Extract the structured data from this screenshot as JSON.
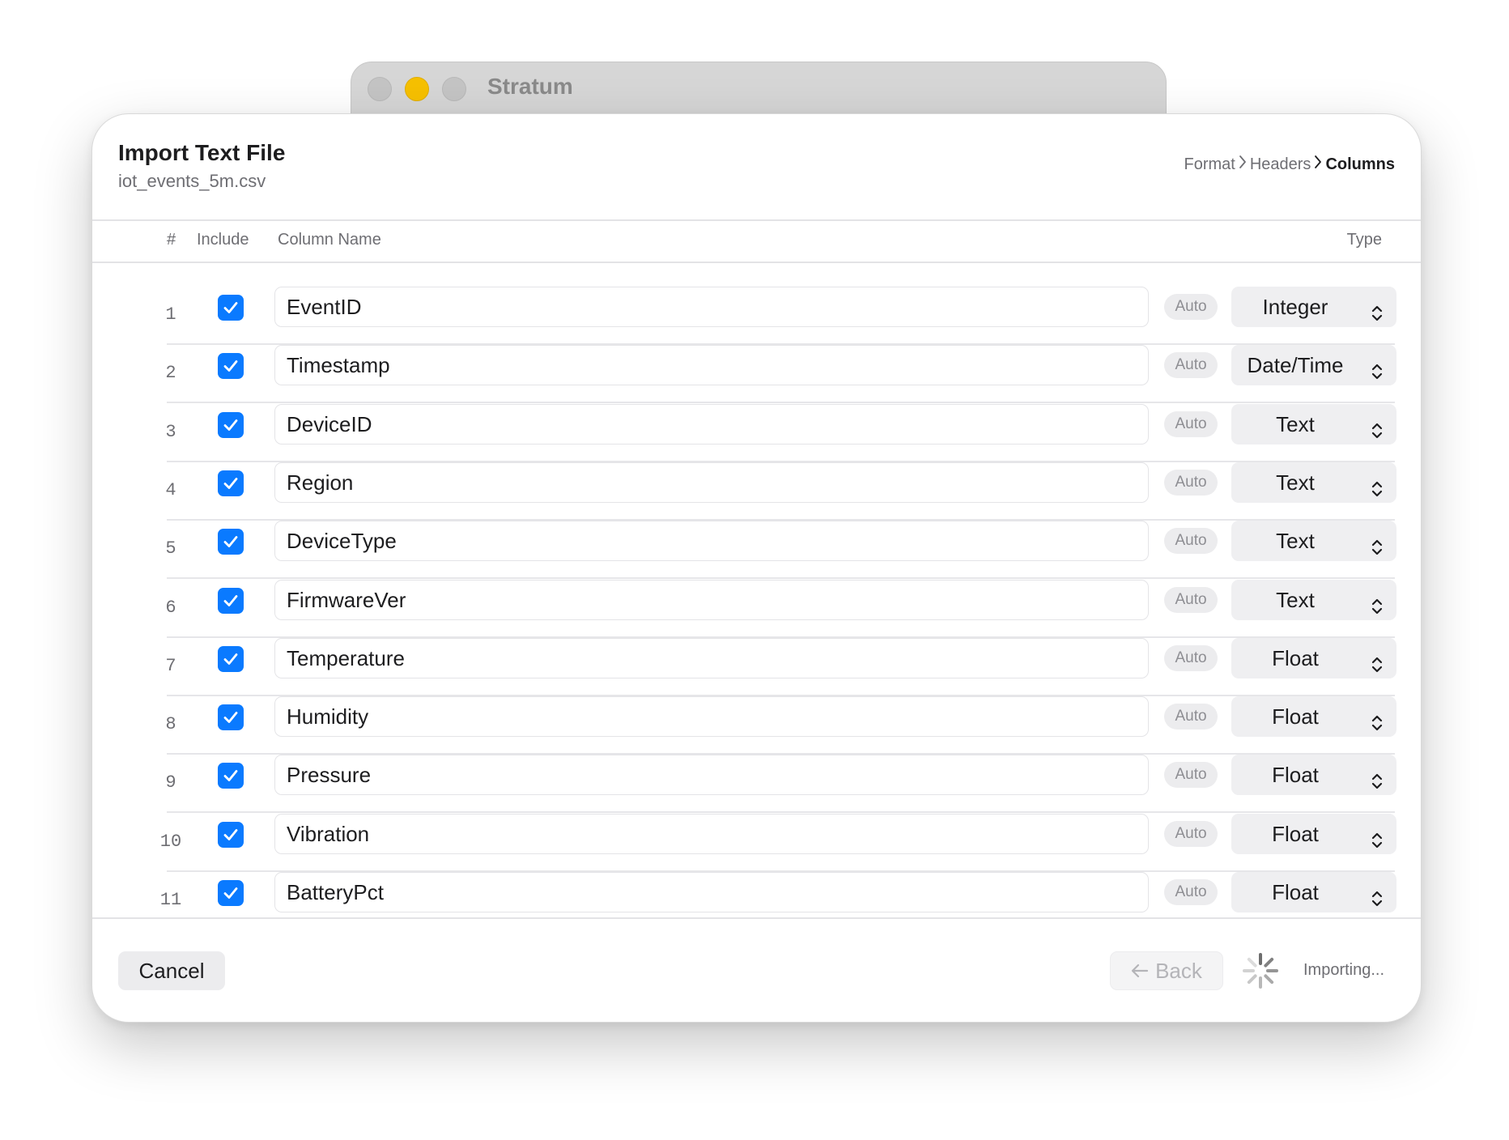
{
  "app": {
    "window_title": "Stratum"
  },
  "dialog": {
    "title": "Import Text File",
    "filename": "iot_events_5m.csv",
    "breadcrumb": [
      {
        "label": "Format",
        "current": false
      },
      {
        "label": "Headers",
        "current": false
      },
      {
        "label": "Columns",
        "current": true
      }
    ]
  },
  "table": {
    "headers": {
      "num": "#",
      "include": "Include",
      "name": "Column Name",
      "type": "Type"
    },
    "rows": [
      {
        "num": "1",
        "included": true,
        "name": "EventID",
        "badge": "Auto",
        "type": "Integer"
      },
      {
        "num": "2",
        "included": true,
        "name": "Timestamp",
        "badge": "Auto",
        "type": "Date/Time"
      },
      {
        "num": "3",
        "included": true,
        "name": "DeviceID",
        "badge": "Auto",
        "type": "Text"
      },
      {
        "num": "4",
        "included": true,
        "name": "Region",
        "badge": "Auto",
        "type": "Text"
      },
      {
        "num": "5",
        "included": true,
        "name": "DeviceType",
        "badge": "Auto",
        "type": "Text"
      },
      {
        "num": "6",
        "included": true,
        "name": "FirmwareVer",
        "badge": "Auto",
        "type": "Text"
      },
      {
        "num": "7",
        "included": true,
        "name": "Temperature",
        "badge": "Auto",
        "type": "Float"
      },
      {
        "num": "8",
        "included": true,
        "name": "Humidity",
        "badge": "Auto",
        "type": "Float"
      },
      {
        "num": "9",
        "included": true,
        "name": "Pressure",
        "badge": "Auto",
        "type": "Float"
      },
      {
        "num": "10",
        "included": true,
        "name": "Vibration",
        "badge": "Auto",
        "type": "Float"
      },
      {
        "num": "11",
        "included": true,
        "name": "BatteryPct",
        "badge": "Auto",
        "type": "Float"
      }
    ]
  },
  "footer": {
    "cancel_label": "Cancel",
    "back_label": "Back",
    "status": "Importing..."
  },
  "colors": {
    "accent": "#0a7aff",
    "traffic_light_active": "#f6c000"
  }
}
